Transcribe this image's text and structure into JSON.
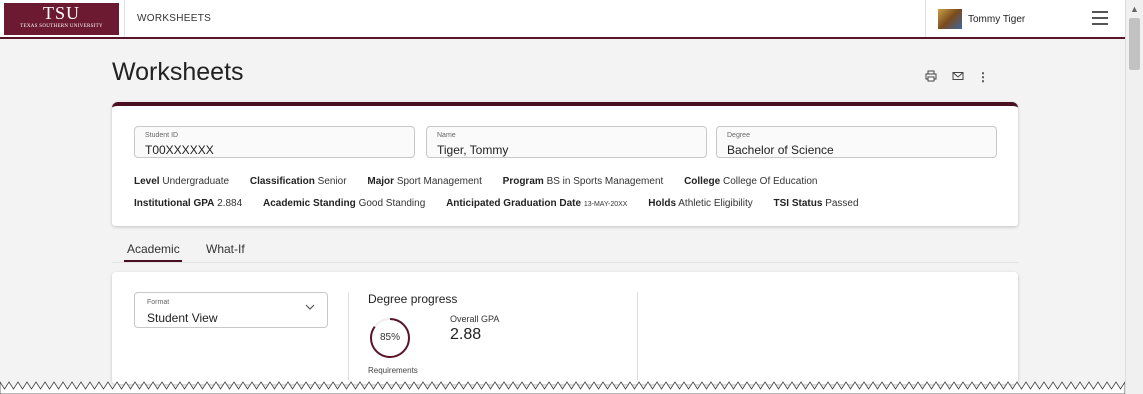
{
  "header": {
    "logo_text": "TSU",
    "logo_subtext": "TEXAS SOUTHERN UNIVERSITY",
    "nav_title": "WORKSHEETS",
    "user_name": "Tommy Tiger"
  },
  "page": {
    "title": "Worksheets"
  },
  "student": {
    "id_label": "Student ID",
    "id_value": "T00XXXXXX",
    "name_label": "Name",
    "name_value": "Tiger, Tommy",
    "degree_label": "Degree",
    "degree_value": "Bachelor of Science",
    "level_label": "Level",
    "level_value": "Undergraduate",
    "classification_label": "Classification",
    "classification_value": "Senior",
    "major_label": "Major",
    "major_value": "Sport Management",
    "program_label": "Program",
    "program_value": "BS in Sports Management",
    "college_label": "College",
    "college_value": "College Of Education",
    "gpa_label": "Institutional GPA",
    "gpa_value": "2.884",
    "standing_label": "Academic Standing",
    "standing_value": "Good Standing",
    "grad_label": "Anticipated Graduation Date",
    "grad_value": "13-MAY-20XX",
    "holds_label": "Holds",
    "holds_value": "Athletic Eligibility",
    "tsi_label": "TSI Status",
    "tsi_value": "Passed"
  },
  "tabs": [
    {
      "label": "Academic",
      "active": true
    },
    {
      "label": "What-If",
      "active": false
    }
  ],
  "progress": {
    "format_label": "Format",
    "format_value": "Student View",
    "title": "Degree progress",
    "percent_text": "85%",
    "percent": 85,
    "gpa_label": "Overall GPA",
    "gpa_value": "2.88",
    "requirements_label": "Requirements"
  },
  "colors": {
    "brand": "#6b1a32",
    "accent": "#4a1022"
  }
}
